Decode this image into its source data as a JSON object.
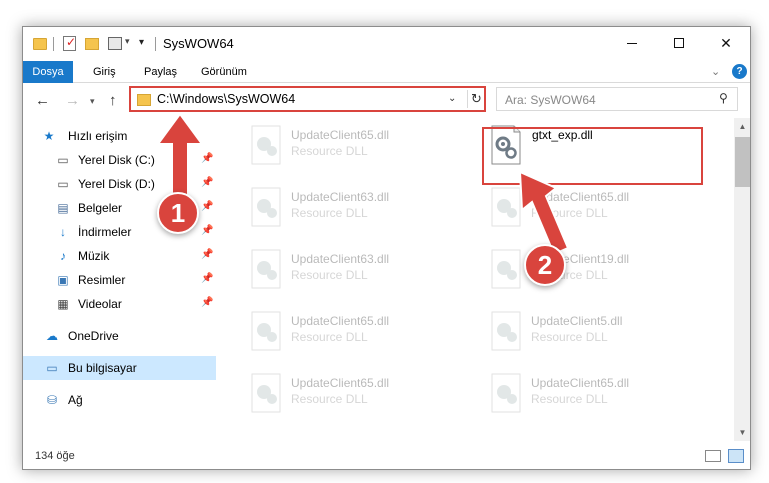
{
  "window": {
    "title": "SysWOW64",
    "controls": {
      "minimize_icon": "minimize-icon",
      "maximize_icon": "maximize-icon",
      "close_label": "✕"
    }
  },
  "ribbon": {
    "tabs": [
      {
        "label": "Dosya",
        "active": true
      },
      {
        "label": "Giriş"
      },
      {
        "label": "Paylaş"
      },
      {
        "label": "Görünüm"
      }
    ],
    "help_label": "?"
  },
  "address_bar": {
    "path": "C:\\Windows\\SysWOW64",
    "refresh_icon": "↻",
    "nav_back_icon": "←",
    "nav_forward_icon": "→",
    "nav_recent_icon": "▾",
    "nav_up_icon": "↑"
  },
  "search": {
    "placeholder": "Ara: SysWOW64",
    "icon": "search-icon"
  },
  "sidebar": {
    "quick_access": {
      "label": "Hızlı erişim",
      "icon": "star-icon"
    },
    "items": [
      {
        "label": "Yerel Disk (C:)",
        "icon": "drive-icon",
        "pinned": true
      },
      {
        "label": "Yerel Disk (D:)",
        "icon": "drive-icon",
        "pinned": true
      },
      {
        "label": "Belgeler",
        "icon": "documents-icon",
        "pinned": true
      },
      {
        "label": "İndirmeler",
        "icon": "downloads-icon",
        "pinned": true
      },
      {
        "label": "Müzik",
        "icon": "music-icon",
        "pinned": true
      },
      {
        "label": "Resimler",
        "icon": "pictures-icon",
        "pinned": true
      },
      {
        "label": "Videolar",
        "icon": "videos-icon",
        "pinned": true
      }
    ],
    "onedrive": {
      "label": "OneDrive",
      "icon": "cloud-icon"
    },
    "this_pc": {
      "label": "Bu bilgisayar",
      "icon": "computer-icon",
      "selected": true
    },
    "network": {
      "label": "Ağ",
      "icon": "network-icon"
    }
  },
  "files": [
    {
      "name": "UpdateClient65.dll",
      "desc": "Resource DLL",
      "faded": true
    },
    {
      "name": "gtxt_exp.dll",
      "desc": "",
      "faded": false,
      "highlighted": true
    },
    {
      "name": "UpdateClient63.dll",
      "desc": "Resource DLL",
      "faded": true
    },
    {
      "name": "UpdateClient65.dll",
      "desc": "Resource DLL",
      "faded": true
    },
    {
      "name": "UpdateClient63.dll",
      "desc": "Resource DLL",
      "faded": true
    },
    {
      "name": "UpdateClient19.dll",
      "desc": "Resource DLL",
      "faded": true
    },
    {
      "name": "UpdateClient65.dll",
      "desc": "Resource DLL",
      "faded": true
    },
    {
      "name": "UpdateClient5.dll",
      "desc": "Resource DLL",
      "faded": true
    },
    {
      "name": "UpdateClient65.dll",
      "desc": "Resource DLL",
      "faded": true
    },
    {
      "name": "UpdateClient65.dll",
      "desc": "Resource DLL",
      "faded": true
    }
  ],
  "status": {
    "item_count": "134 öğe"
  },
  "annotations": [
    {
      "number": "1",
      "target": "address-bar"
    },
    {
      "number": "2",
      "target": "gtxt_exp.dll"
    }
  ],
  "colors": {
    "accent": "#1979ca",
    "highlight": "#d9443d",
    "selection": "#cce8ff"
  }
}
